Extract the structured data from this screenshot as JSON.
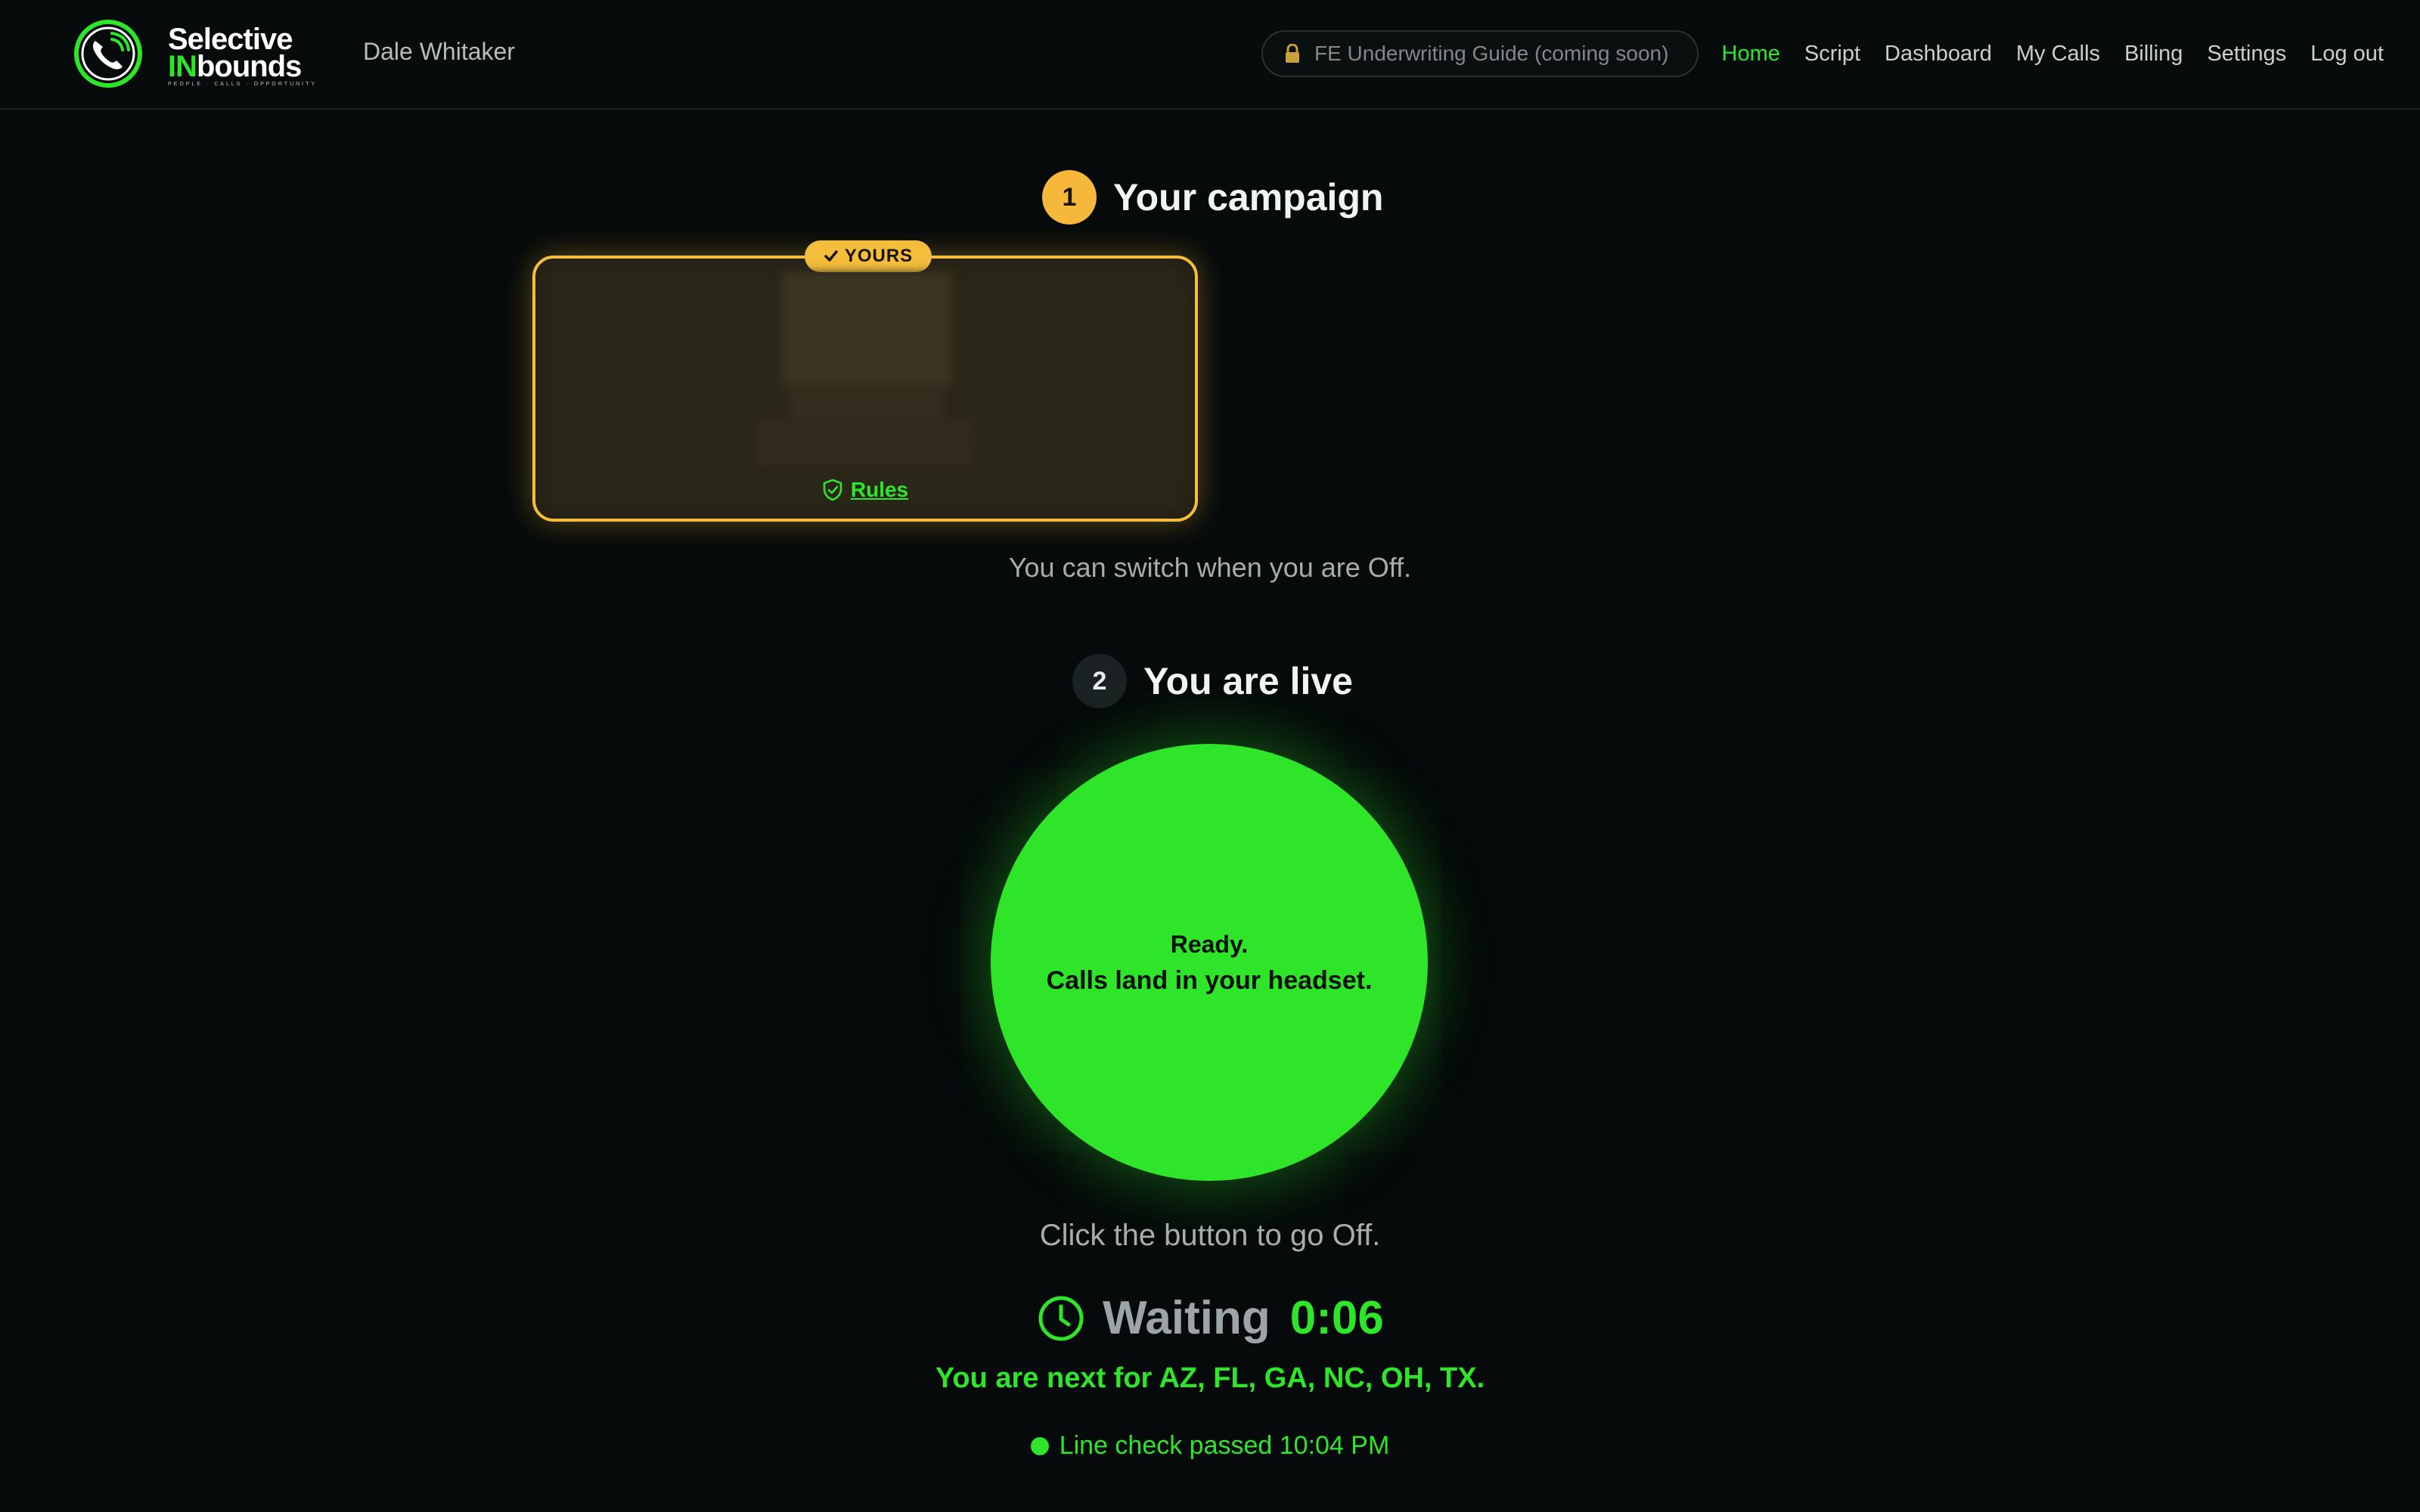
{
  "header": {
    "logo": {
      "line1": "Selective",
      "line2_highlight": "IN",
      "line2_rest": "bounds",
      "tagline": "PEOPLE · CALLS · OPPORTUNITY",
      "icon": "phone-signal-icon"
    },
    "user_name": "Dale Whitaker",
    "guide_pill": {
      "label": "FE Underwriting Guide (coming soon)",
      "icon": "lock-icon"
    },
    "nav": [
      {
        "label": "Home",
        "active": true
      },
      {
        "label": "Script",
        "active": false
      },
      {
        "label": "Dashboard",
        "active": false
      },
      {
        "label": "My Calls",
        "active": false
      },
      {
        "label": "Billing",
        "active": false
      },
      {
        "label": "Settings",
        "active": false
      },
      {
        "label": "Log out",
        "active": false
      }
    ]
  },
  "step1": {
    "number": "1",
    "title": "Your campaign",
    "card": {
      "badge": "YOURS",
      "badge_icon": "check-icon",
      "rules_label": "Rules",
      "rules_icon": "shield-check-icon"
    },
    "note": "You can switch when you are Off."
  },
  "step2": {
    "number": "2",
    "title": "You are live",
    "button": {
      "line1": "Ready.",
      "line2": "Calls land in your headset."
    },
    "note": "Click the button to go Off.",
    "waiting": {
      "label": "Waiting",
      "time": "0:06",
      "icon": "clock-icon"
    },
    "next_note": "You are next for AZ, FL, GA, NC, OH, TX.",
    "line_check": "Line check passed 10:04 PM"
  },
  "colors": {
    "accent_green": "#2fe52a",
    "accent_gold": "#f5bd3c",
    "background": "#060a0b"
  }
}
